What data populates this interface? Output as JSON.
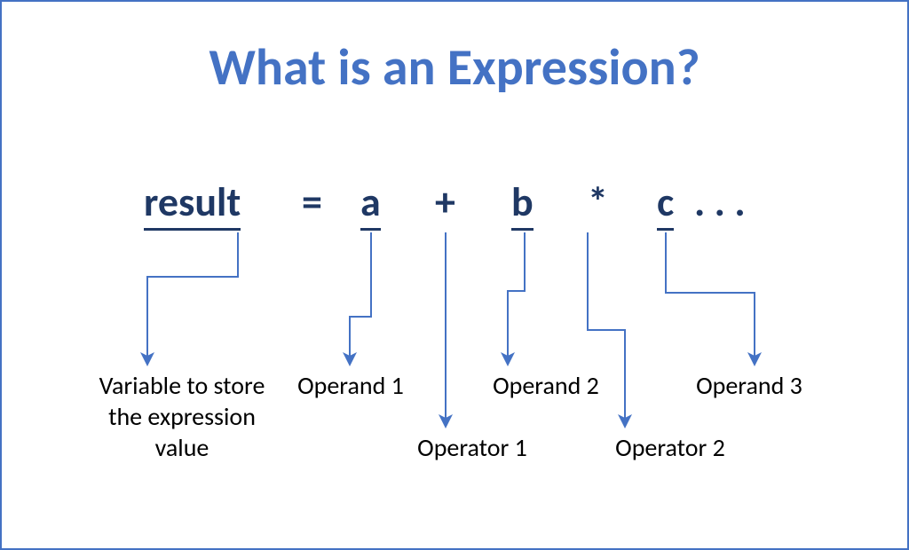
{
  "title": "What is an Expression?",
  "expression": {
    "result": "result",
    "equals": "=",
    "a": "a",
    "plus": "+",
    "b": "b",
    "times": "*",
    "c": "c",
    "dots": ". . ."
  },
  "labels": {
    "variable": "Variable to store\nthe expression\nvalue",
    "operand1": "Operand 1",
    "operand2": "Operand 2",
    "operand3": "Operand 3",
    "operator1": "Operator 1",
    "operator2": "Operator 2"
  },
  "colors": {
    "border": "#4472C4",
    "title": "#4472C4",
    "token": "#1F3864",
    "arrow": "#4472C4"
  }
}
